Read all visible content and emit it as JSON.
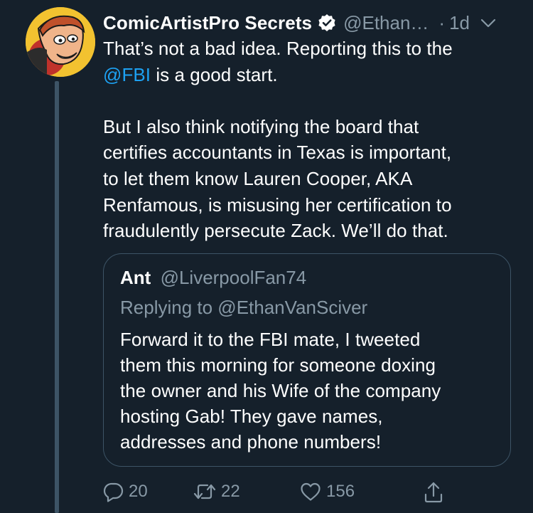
{
  "tweet": {
    "display_name": "ComicArtistPro Secrets",
    "handle": "@Ethan…",
    "separator": "·",
    "time": "1d",
    "text_lines_1": [
      "That’s not a bad idea. Reporting this to the"
    ],
    "mention": "@FBI",
    "mention_suffix": " is a good start.",
    "text_lines_2": [
      "But I also think notifying the board that",
      "certifies accountants in Texas is important,",
      "to let them know Lauren Cooper, AKA",
      "Renfamous, is misusing her certification to",
      "fraudulently persecute Zack. We’ll do that."
    ]
  },
  "quote": {
    "name": "Ant",
    "handle": "@LiverpoolFan74",
    "replying_to": "Replying to @EthanVanSciver",
    "lines": [
      "Forward it to the FBI mate, I tweeted",
      "them this morning for someone doxing",
      "the owner and his Wife of the company",
      "hosting Gab!  They gave names,",
      "addresses and phone numbers!"
    ]
  },
  "actions": {
    "reply_count": "20",
    "retweet_count": "22",
    "like_count": "156"
  },
  "colors": {
    "background": "#15202b",
    "text": "#ffffff",
    "secondary": "#8899a6",
    "accent": "#1da1f2",
    "border": "#3d5466"
  },
  "icons": {
    "verified": "verified-badge-icon",
    "menu": "chevron-down-icon",
    "reply": "reply-icon",
    "retweet": "retweet-icon",
    "like": "heart-icon",
    "share": "share-icon"
  }
}
